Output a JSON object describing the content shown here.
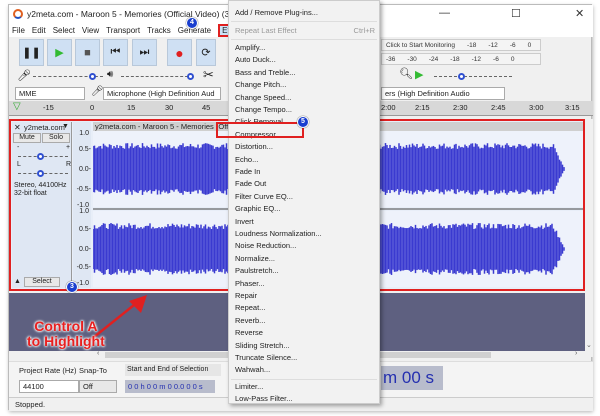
{
  "window": {
    "title": "y2meta.com - Maroon 5 - Memories (Official Video) (320 kbps)",
    "minimize": "—",
    "maximize": "☐",
    "close": "✕"
  },
  "menubar": [
    "File",
    "Edit",
    "Select",
    "View",
    "Transport",
    "Tracks",
    "Generate",
    "Effect"
  ],
  "transport": {
    "pause": "❚❚",
    "play": "▶",
    "stop": "■",
    "skip_start": "⏮",
    "skip_end": "⏭",
    "record": "●",
    "loop": "⟳"
  },
  "meters": {
    "record_ticks": [
      "Click to Start Monitoring",
      "-18",
      "-12",
      "-6",
      "0"
    ],
    "play_ticks": [
      "-36",
      "-30",
      "-24",
      "-18",
      "-12",
      "-6",
      "0"
    ]
  },
  "device": {
    "host": "MME",
    "input": "Microphone (High Definition Aud",
    "output": "ers (High Definition Audio"
  },
  "ruler": [
    "-15",
    "0",
    "15",
    "30",
    "45",
    "2:00",
    "2:15",
    "2:30",
    "2:45",
    "3:00",
    "3:15"
  ],
  "track": {
    "name": "y2meta.com",
    "clip_title": "y2meta.com - Maroon 5 - Memories (Official Video)",
    "mute": "Mute",
    "solo": "Solo",
    "gain_minus": "-",
    "gain_plus": "+",
    "pan_l": "L",
    "pan_r": "R",
    "info1": "Stereo, 44100Hz",
    "info2": "32-bit float",
    "select": "Select",
    "scale": [
      "1.0",
      "0.5-",
      "0.0-",
      "-0.5-",
      "-1.0"
    ],
    "wave_color": "#3a3ad0"
  },
  "annotations": {
    "badge_effect": "4",
    "badge_compressor": "5",
    "badge_track": "3",
    "callout_line1": "Control A",
    "callout_line2": "to Highlight",
    "accent": "#e02020"
  },
  "effect_menu": {
    "top": [
      "Add / Remove Plug-ins..."
    ],
    "repeat": {
      "label": "Repeat Last Effect",
      "shortcut": "Ctrl+R"
    },
    "items": [
      "Amplify...",
      "Auto Duck...",
      "Bass and Treble...",
      "Change Pitch...",
      "Change Speed...",
      "Change Tempo...",
      "Click Removal...",
      "Compressor...",
      "Distortion...",
      "Echo...",
      "Fade In",
      "Fade Out",
      "Filter Curve EQ...",
      "Graphic EQ...",
      "Invert",
      "Loudness Normalization...",
      "Noise Reduction...",
      "Normalize...",
      "Paulstretch...",
      "Phaser...",
      "Repair",
      "Repeat...",
      "Reverb...",
      "Reverse",
      "Sliding Stretch...",
      "Truncate Silence...",
      "Wahwah..."
    ],
    "bottom": [
      "Limiter...",
      "Low-Pass Filter..."
    ],
    "highlighted": "Compressor..."
  },
  "bottombar": {
    "rate_label": "Project Rate (Hz)",
    "rate": "44100",
    "snap_label": "Snap-To",
    "snap": "Off",
    "sel_label": "Start and End of Selection",
    "sel_value": "0 0 h 0 0 m 0 0.0 0 0 s",
    "big_time": "m 00 s"
  },
  "status": "Stopped."
}
